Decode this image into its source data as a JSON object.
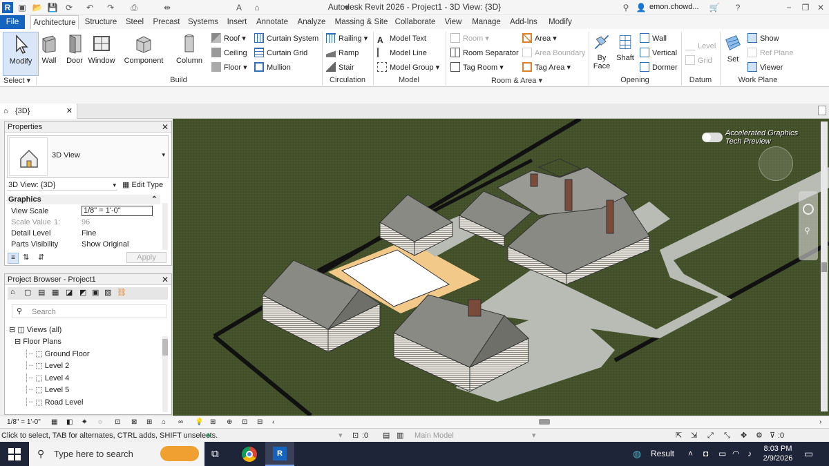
{
  "window": {
    "title": "Autodesk Revit 2026 - Project1 - 3D View: {3D}",
    "user": "emon.chowd...",
    "logo_letter": "R"
  },
  "ribbon_tabs": [
    "File",
    "Architecture",
    "Structure",
    "Steel",
    "Precast",
    "Systems",
    "Insert",
    "Annotate",
    "Analyze",
    "Massing & Site",
    "Collaborate",
    "View",
    "Manage",
    "Add-Ins",
    "Modify"
  ],
  "ribbon": {
    "select": {
      "modify": "Modify",
      "panel": "Select"
    },
    "build": {
      "wall": "Wall",
      "door": "Door",
      "window": "Window",
      "component": "Component",
      "column": "Column",
      "roof": "Roof",
      "ceiling": "Ceiling",
      "floor": "Floor",
      "curtain_system": "Curtain System",
      "curtain_grid": "Curtain Grid",
      "mullion": "Mullion",
      "panel": "Build"
    },
    "circulation": {
      "railing": "Railing",
      "ramp": "Ramp",
      "stair": "Stair",
      "panel": "Circulation"
    },
    "model": {
      "model_text": "Model Text",
      "model_line": "Model Line",
      "model_group": "Model Group",
      "panel": "Model"
    },
    "room_area": {
      "room": "Room",
      "room_separator": "Room Separator",
      "tag_room": "Tag Room",
      "area": "Area",
      "area_boundary": "Area Boundary",
      "tag_area": "Tag Area",
      "panel": "Room & Area"
    },
    "opening": {
      "by_face_1": "By",
      "by_face_2": "Face",
      "shaft": "Shaft",
      "wall": "Wall",
      "vertical": "Vertical",
      "dormer": "Dormer",
      "panel": "Opening"
    },
    "datum": {
      "level": "Level",
      "grid": "Grid",
      "panel": "Datum"
    },
    "work_plane": {
      "set": "Set",
      "show": "Show",
      "ref_plane": "Ref Plane",
      "viewer": "Viewer",
      "panel": "Work Plane"
    }
  },
  "view_tab": {
    "label": "{3D}"
  },
  "properties": {
    "title": "Properties",
    "type_name": "3D View",
    "selector": "3D View: {3D}",
    "edit_type": "Edit Type",
    "section": "Graphics",
    "rows": [
      {
        "name": "View Scale",
        "value": "1/8\" = 1'-0\""
      },
      {
        "name": "Scale Value",
        "prefix": "1:",
        "value": "96"
      },
      {
        "name": "Detail Level",
        "value": "Fine"
      },
      {
        "name": "Parts Visibility",
        "value": "Show Original"
      }
    ],
    "apply": "Apply"
  },
  "project_browser": {
    "title": "Project Browser - Project1",
    "search_placeholder": "Search",
    "views_all": "Views (all)",
    "floor_plans": "Floor Plans",
    "items": [
      "Ground Floor",
      "Level 2",
      "Level 4",
      "Level 5",
      "Road Level"
    ]
  },
  "viewport": {
    "accel_line1": "Accelerated Graphics",
    "accel_line2": "Tech Preview"
  },
  "view_control": {
    "scale": "1/8\" = 1'-0\""
  },
  "status": {
    "hint": "Click to select, TAB for alternates, CTRL adds, SHIFT unselects.",
    "workset_count": ":0",
    "main_model": "Main Model",
    "filter_count": ":0"
  },
  "taskbar": {
    "search_placeholder": "Type here to search",
    "weather": "Result",
    "time": "8:03 PM",
    "date": "2/9/2026"
  },
  "colors": {
    "file_tab": "#1565c0",
    "terrain": "#44512a",
    "roof": "#8a8a84",
    "road": "#b9bcb4",
    "pad": "#f3c98a",
    "taskbar": "#1f2538"
  }
}
